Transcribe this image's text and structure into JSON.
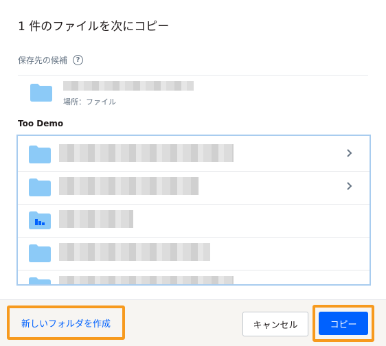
{
  "dialog": {
    "title": "1 件のファイルを次にコピー",
    "suggestions_label": "保存先の候補",
    "help_symbol": "?",
    "suggestion": {
      "location": "場所：ファイル"
    },
    "section_label": "Too Demo",
    "footer": {
      "new_folder_label": "新しいフォルダを作成",
      "cancel_label": "キャンセル",
      "copy_label": "コピー"
    }
  },
  "colors": {
    "folder": "#8ccaf7",
    "accent": "#0061fe",
    "highlight": "#f79a1e",
    "list_border": "#a8ccef"
  },
  "icons": {
    "help": "help-circle-icon",
    "folder": "folder-icon",
    "shared_folder": "team-folder-icon",
    "chevron": "chevron-right-icon"
  }
}
